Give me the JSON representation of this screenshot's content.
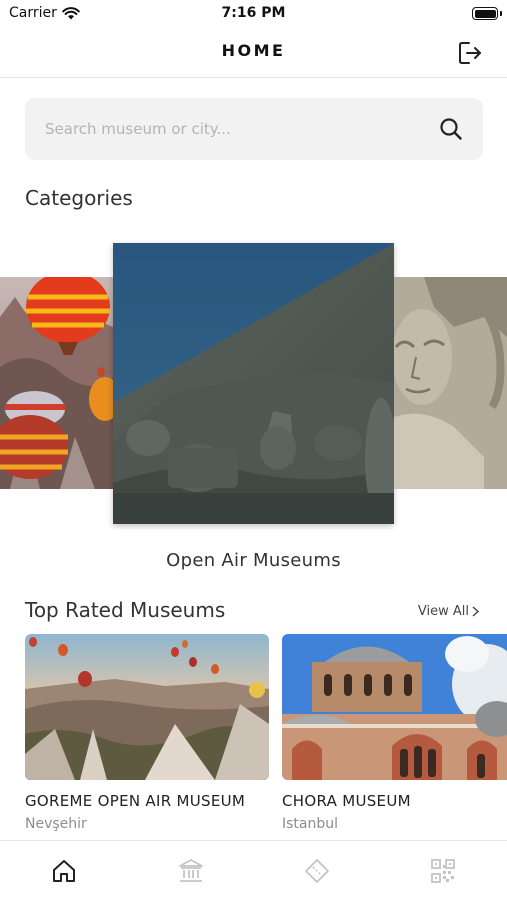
{
  "status_bar": {
    "carrier": "Carrier",
    "time": "7:16 PM",
    "battery_level": 1.0
  },
  "header": {
    "title": "HOME",
    "logout_icon": "logout-icon"
  },
  "search": {
    "placeholder": "Search museum or city...",
    "value": "",
    "icon": "search-icon"
  },
  "categories": {
    "title": "Categories",
    "current_label": "Open Air Museums"
  },
  "top_rated": {
    "title": "Top Rated Museums",
    "view_all_label": "View All",
    "museums": [
      {
        "name": "GOREME OPEN AIR MUSEUM",
        "city": "Nevşehir"
      },
      {
        "name": "CHORA MUSEUM",
        "city": "Istanbul"
      }
    ]
  },
  "tab_bar": {
    "items": [
      {
        "icon": "home-icon",
        "selected": true
      },
      {
        "icon": "museum-icon",
        "selected": false
      },
      {
        "icon": "ticket-icon",
        "selected": false
      },
      {
        "icon": "qr-code-icon",
        "selected": false
      }
    ]
  },
  "colors": {
    "accent": "#222222",
    "inactive_tab": "#c4c4c4",
    "search_bg": "#f2f2f3"
  }
}
